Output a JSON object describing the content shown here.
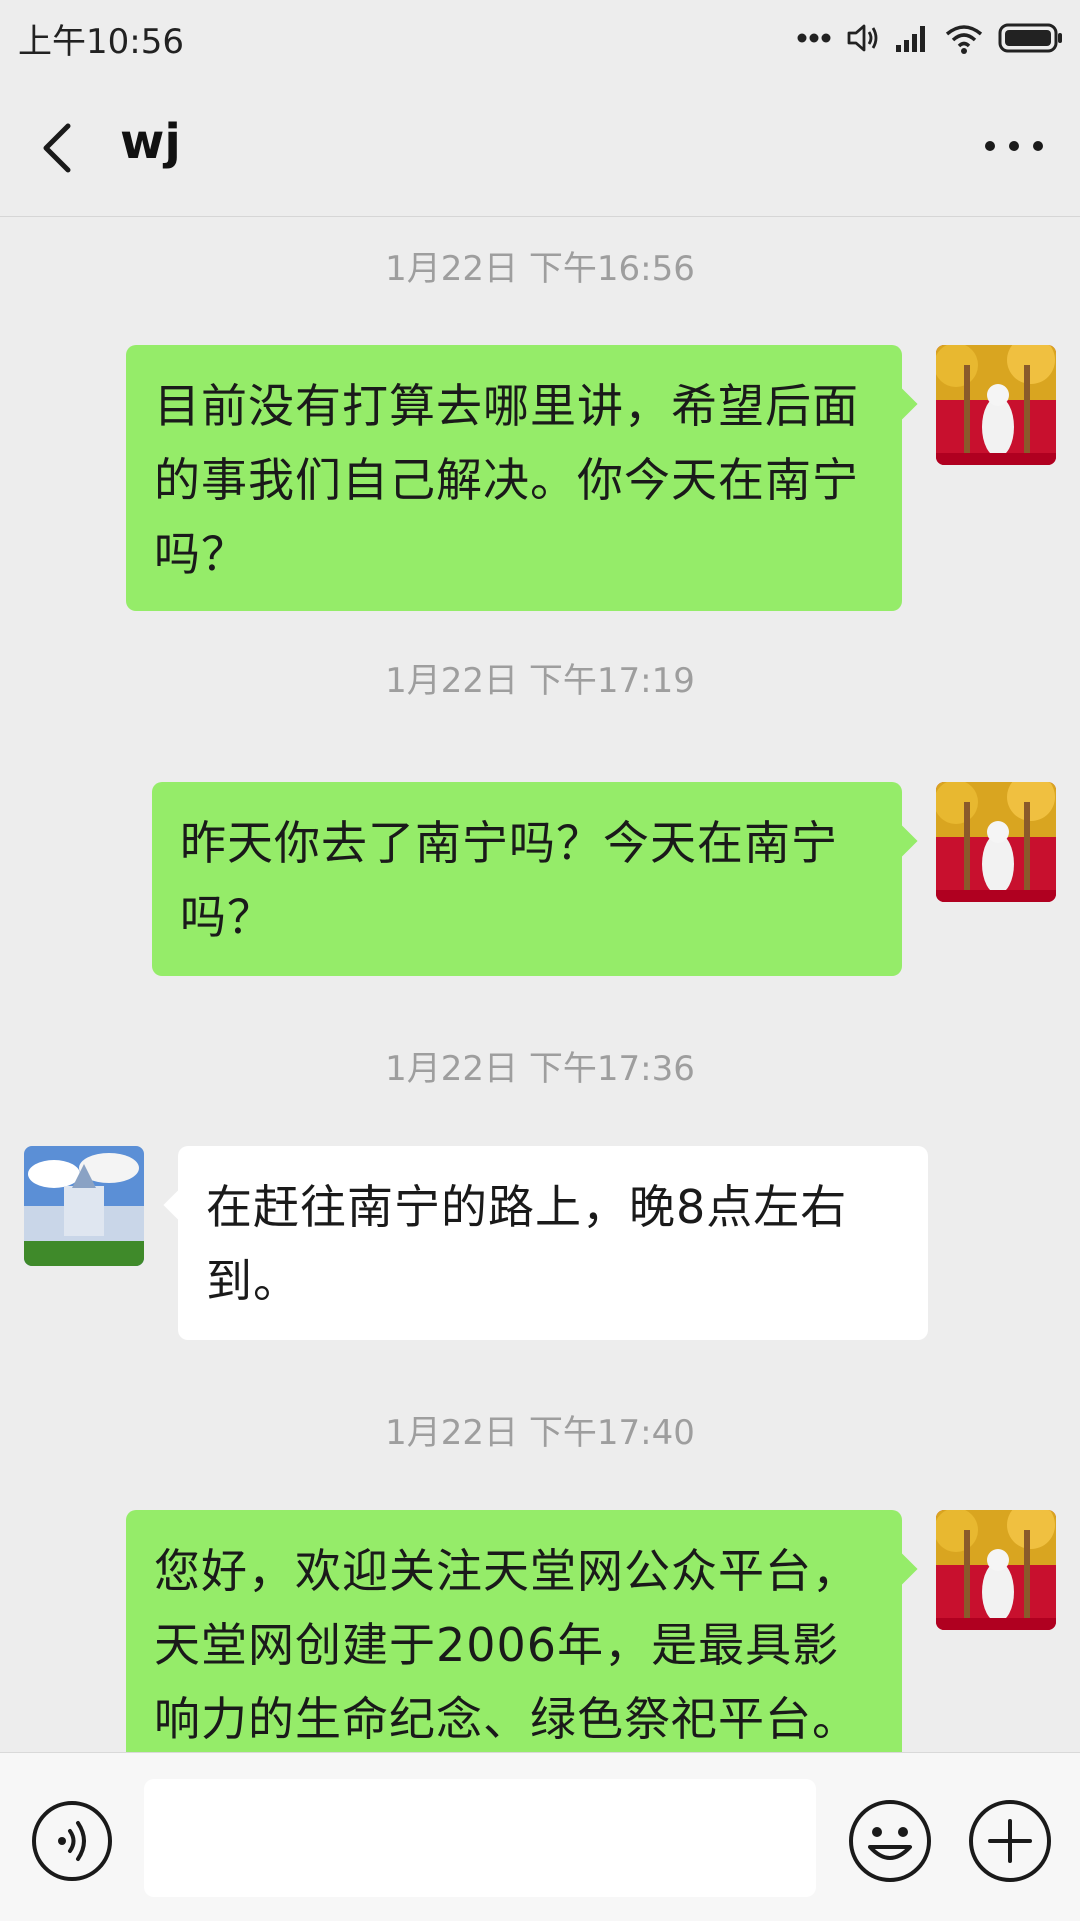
{
  "status_bar": {
    "time": "上午10:56",
    "icons": [
      "more-dots-icon",
      "volume-icon",
      "signal-icon",
      "wifi-icon",
      "battery-icon"
    ]
  },
  "header": {
    "title": "wj",
    "back_icon": "chevron-left-icon",
    "more_icon": "more-horizontal-icon"
  },
  "messages": [
    {
      "timestamp": "1月22日 下午16:56",
      "side": "right",
      "text": "目前没有打算去哪里讲，希望后面的事我们自己解决。你今天在南宁吗？"
    },
    {
      "timestamp": "1月22日 下午17:19",
      "side": "right",
      "text": "昨天你去了南宁吗？今天在南宁吗？"
    },
    {
      "timestamp": "1月22日 下午17:36",
      "side": "left",
      "text": "在赶往南宁的路上，晚8点左右到。"
    },
    {
      "timestamp": "1月22日 下午17:40",
      "side": "right",
      "text": "您好，欢迎关注天堂网公众平台，天堂网创建于2006年，是最具影响力的生命纪念、绿色祭祀平台。"
    }
  ],
  "input_bar": {
    "value": "",
    "icons": [
      "voice-icon",
      "emoji-icon",
      "plus-icon"
    ]
  },
  "colors": {
    "background": "#ededed",
    "sent_bubble": "#95ec69",
    "received_bubble": "#ffffff",
    "timestamp_text": "#9e9e9e"
  }
}
